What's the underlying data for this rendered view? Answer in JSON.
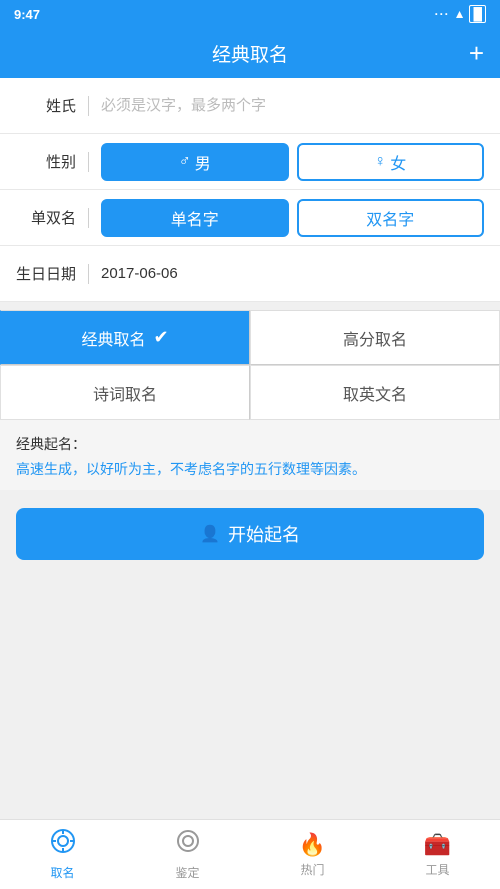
{
  "statusBar": {
    "time": "9:47"
  },
  "header": {
    "title": "经典取名",
    "plusLabel": "+"
  },
  "form": {
    "surname": {
      "label": "姓氏",
      "placeholder": "必须是汉字，最多两个字"
    },
    "gender": {
      "label": "性别",
      "options": [
        {
          "id": "male",
          "icon": "♂",
          "label": "男",
          "active": true
        },
        {
          "id": "female",
          "icon": "♀",
          "label": "女",
          "active": false
        }
      ]
    },
    "singleDouble": {
      "label": "单双名",
      "options": [
        {
          "id": "single",
          "label": "单名字",
          "active": true
        },
        {
          "id": "double",
          "label": "双名字",
          "active": false
        }
      ]
    },
    "birthday": {
      "label": "生日日期",
      "value": "2017-06-06"
    }
  },
  "nameTypes": [
    {
      "id": "classic",
      "label": "经典取名",
      "active": true,
      "showCheck": true
    },
    {
      "id": "highscore",
      "label": "高分取名",
      "active": false,
      "showCheck": false
    },
    {
      "id": "poetry",
      "label": "诗词取名",
      "active": false,
      "showCheck": false
    },
    {
      "id": "english",
      "label": "取英文名",
      "active": false,
      "showCheck": false
    }
  ],
  "description": {
    "title": "经典起名：",
    "body": "高速生成，以好听为主，不考虑名字的五行数理等因素。"
  },
  "startButton": {
    "icon": "👤",
    "label": "开始起名"
  },
  "bottomNav": {
    "items": [
      {
        "id": "naming",
        "label": "取名",
        "icon": "⚙",
        "active": true
      },
      {
        "id": "appraise",
        "label": "鉴定",
        "icon": "◎",
        "active": false
      },
      {
        "id": "hot",
        "label": "热门",
        "icon": "🔥",
        "active": false
      },
      {
        "id": "tools",
        "label": "工具",
        "icon": "🧰",
        "active": false
      }
    ]
  }
}
